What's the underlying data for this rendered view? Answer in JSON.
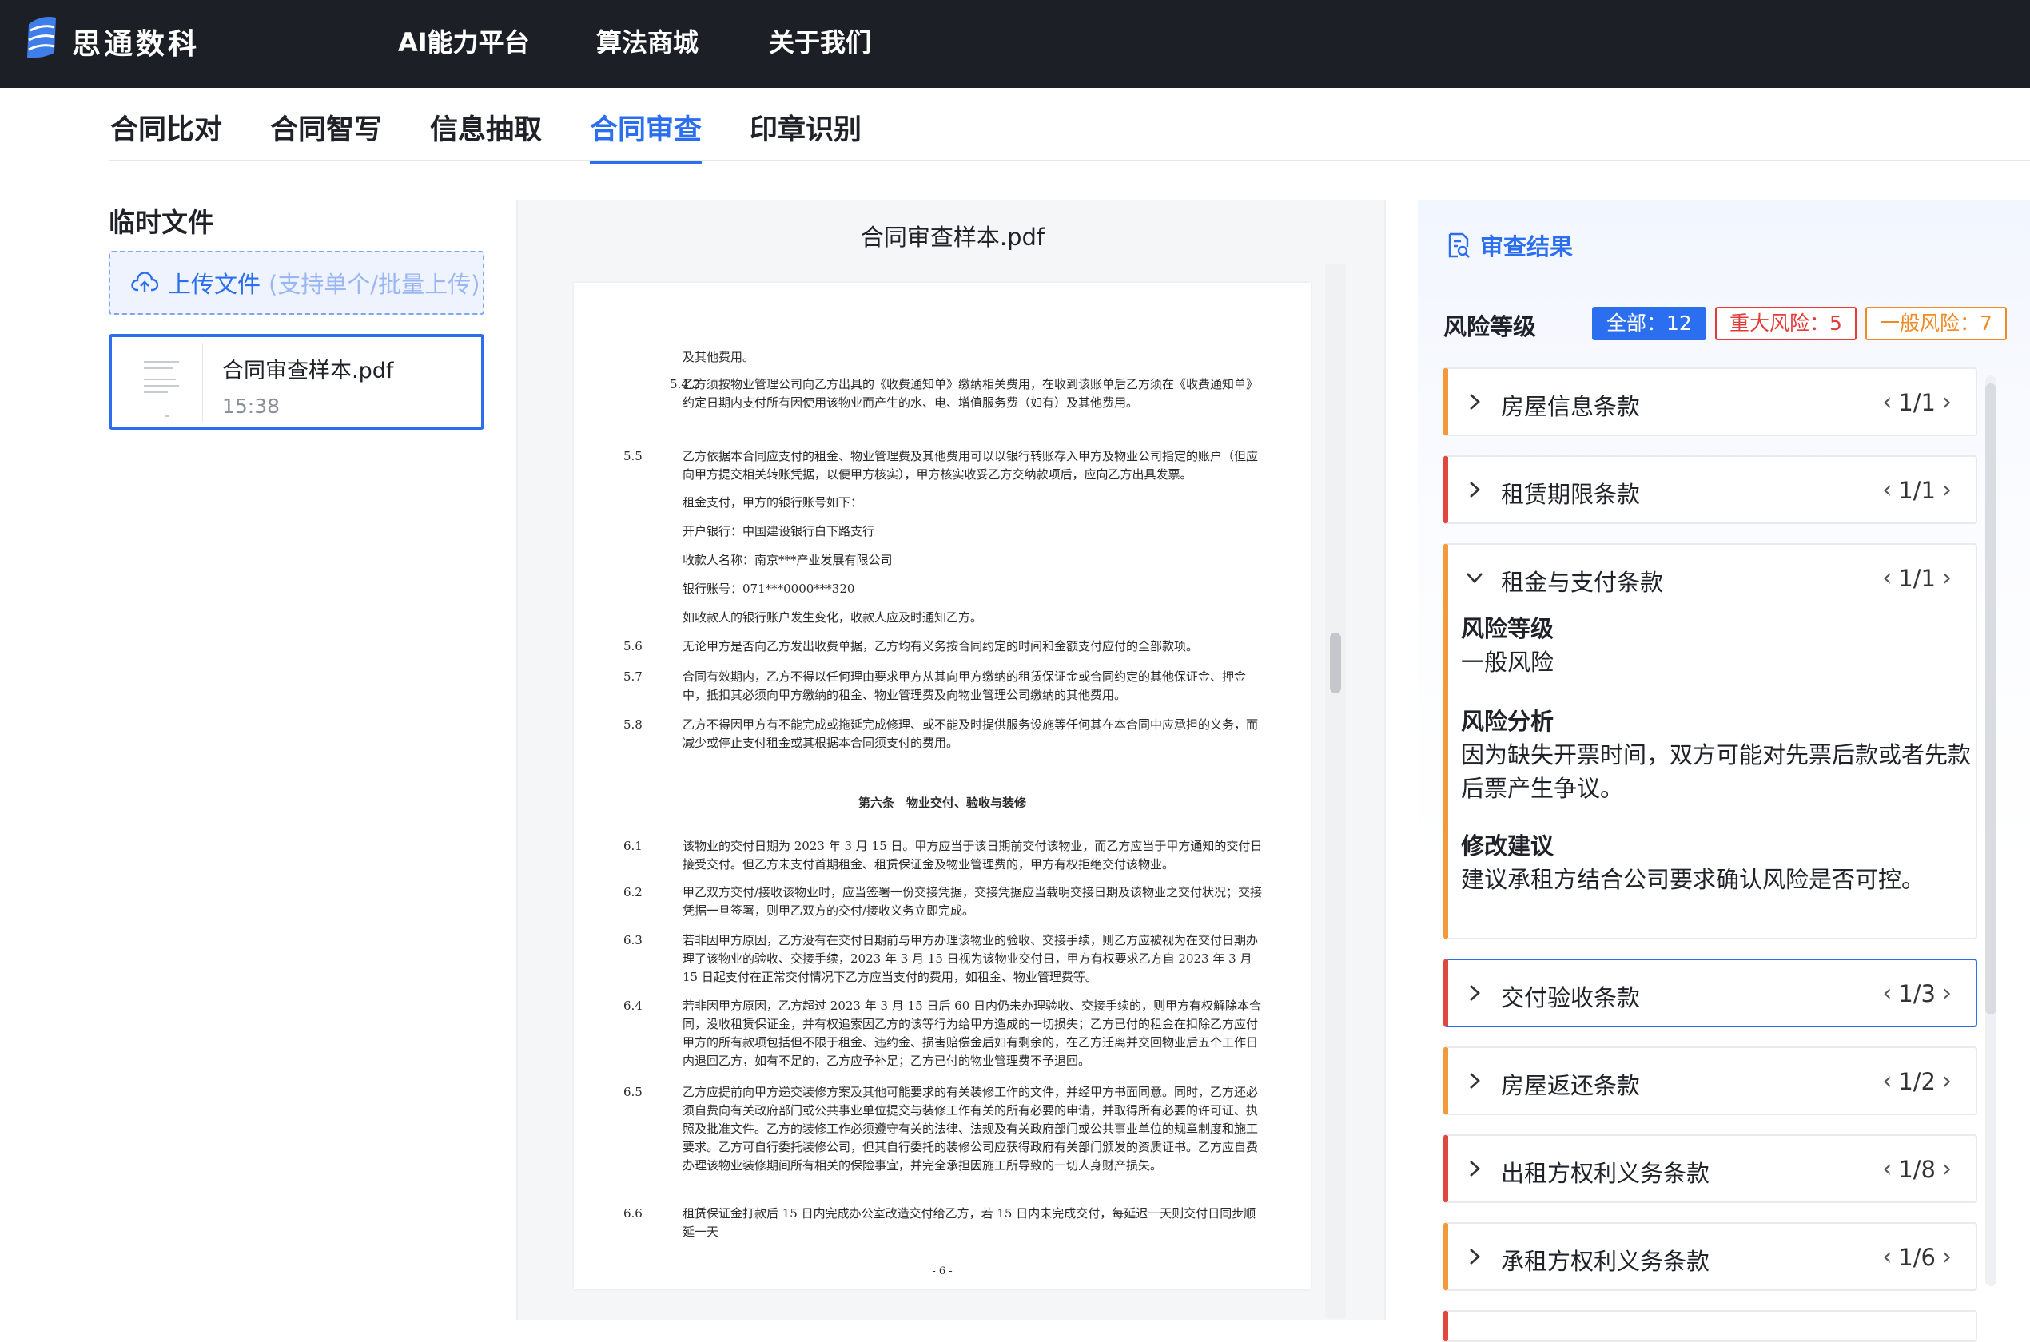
{
  "app": {
    "brand": "思通数科"
  },
  "topnav": [
    {
      "label": "AI能力平台"
    },
    {
      "label": "算法商城"
    },
    {
      "label": "关于我们"
    }
  ],
  "tabs": [
    {
      "label": "合同比对",
      "active": false
    },
    {
      "label": "合同智写",
      "active": false
    },
    {
      "label": "信息抽取",
      "active": false
    },
    {
      "label": "合同审查",
      "active": true
    },
    {
      "label": "印章识别",
      "active": false
    }
  ],
  "sidebar": {
    "title": "临时文件",
    "upload_label": "上传文件",
    "upload_hint": "(支持单个/批量上传)",
    "files": [
      {
        "name": "合同审查样本.pdf",
        "time": "15:38"
      }
    ]
  },
  "viewer": {
    "title": "合同审查样本.pdf",
    "page_number": "- 6 -",
    "clauses": [
      {
        "num": "",
        "text": "及其他费用。"
      },
      {
        "num": "5.4.2",
        "text": "乙方须按物业管理公司向乙方出具的《收费通知单》缴纳相关费用，在收到该账单后乙方须在《收费通知单》约定日期内支付所有因使用该物业而产生的水、电、增值服务费（如有）及其他费用。"
      },
      {
        "num": "5.5",
        "text": "乙方依据本合同应支付的租金、物业管理费及其他费用可以以银行转账存入甲方及物业公司指定的账户（但应向甲方提交相关转账凭据，以便甲方核实），甲方核实收妥乙方交纳款项后，应向乙方出具发票。"
      },
      {
        "num": "",
        "text": "租金支付，甲方的银行账号如下："
      },
      {
        "num": "",
        "text": "开户银行：中国建设银行白下路支行"
      },
      {
        "num": "",
        "text": "收款人名称：南京***产业发展有限公司"
      },
      {
        "num": "",
        "text": "银行账号：071***0000***320"
      },
      {
        "num": "",
        "text": "如收款人的银行账户发生变化，收款人应及时通知乙方。"
      },
      {
        "num": "5.6",
        "text": "无论甲方是否向乙方发出收费单据，乙方均有义务按合同约定的时间和金额支付应付的全部款项。"
      },
      {
        "num": "5.7",
        "text": "合同有效期内，乙方不得以任何理由要求甲方从其向甲方缴纳的租赁保证金或合同约定的其他保证金、押金中，抵扣其必须向甲方缴纳的租金、物业管理费及向物业管理公司缴纳的其他费用。"
      },
      {
        "num": "5.8",
        "text": "乙方不得因甲方有不能完成或拖延完成修理、或不能及时提供服务设施等任何其在本合同中应承担的义务，而减少或停止支付租金或其根据本合同须支付的费用。"
      },
      {
        "num": "",
        "text": "第六条　物业交付、验收与装修"
      },
      {
        "num": "6.1",
        "text": "该物业的交付日期为 2023 年 3 月 15 日。甲方应当于该日期前交付该物业，而乙方应当于甲方通知的交付日接受交付。但乙方未支付首期租金、租赁保证金及物业管理费的，甲方有权拒绝交付该物业。"
      },
      {
        "num": "6.2",
        "text": "甲乙双方交付/接收该物业时，应当签署一份交接凭据，交接凭据应当载明交接日期及该物业之交付状况；交接凭据一旦签署，则甲乙双方的交付/接收义务立即完成。"
      },
      {
        "num": "6.3",
        "text": "若非因甲方原因，乙方没有在交付日期前与甲方办理该物业的验收、交接手续，则乙方应被视为在交付日期办理了该物业的验收、交接手续，2023 年 3 月 15 日视为该物业交付日，甲方有权要求乙方自 2023 年 3 月 15 日起支付在正常交付情况下乙方应当支付的费用，如租金、物业管理费等。"
      },
      {
        "num": "6.4",
        "text": "若非因甲方原因，乙方超过 2023 年 3 月 15 日后 60 日内仍未办理验收、交接手续的，则甲方有权解除本合同，没收租赁保证金，并有权追索因乙方的该等行为给甲方造成的一切损失；乙方已付的租金在扣除乙方应付甲方的所有款项包括但不限于租金、违约金、损害赔偿金后如有剩余的，在乙方迁离并交回物业后五个工作日内退回乙方，如有不足的，乙方应予补足；乙方已付的物业管理费不予退回。"
      },
      {
        "num": "6.5",
        "text": "乙方应提前向甲方递交装修方案及其他可能要求的有关装修工作的文件，并经甲方书面同意。同时，乙方还必须自费向有关政府部门或公共事业单位提交与装修工作有关的所有必要的申请，并取得所有必要的许可证、执照及批准文件。乙方的装修工作必须遵守有关的法律、法规及有关政府部门或公共事业单位的规章制度和施工要求。乙方可自行委托装修公司，但其自行委托的装修公司应获得政府有关部门颁发的资质证书。乙方应自费办理该物业装修期间所有相关的保险事宜，并完全承担因施工所导致的一切人身财产损失。"
      },
      {
        "num": "6.6",
        "text": "租赁保证金打款后 15 日内完成办公室改造交付给乙方，若 15 日内未完成交付，每延迟一天则交付日同步顺延一天"
      }
    ]
  },
  "results": {
    "title": "审查结果",
    "risk_label": "风险等级",
    "filters": {
      "all": "全部：12",
      "major": "重大风险：5",
      "minor": "一般风险：7"
    },
    "items": [
      {
        "name": "房屋信息条款",
        "pager": "1/1",
        "level": "minor",
        "expanded": false
      },
      {
        "name": "租赁期限条款",
        "pager": "1/1",
        "level": "major",
        "expanded": false
      },
      {
        "name": "租金与支付条款",
        "pager": "1/1",
        "level": "minor",
        "expanded": true,
        "detail": {
          "risk_level_label": "风险等级",
          "risk_level": "一般风险",
          "analysis_label": "风险分析",
          "analysis": "因为缺失开票时间，双方可能对先票后款或者先款后票产生争议。",
          "advice_label": "修改建议",
          "advice": "建议承租方结合公司要求确认风险是否可控。"
        }
      },
      {
        "name": "交付验收条款",
        "pager": "1/3",
        "level": "major",
        "expanded": false,
        "selected": true
      },
      {
        "name": "房屋返还条款",
        "pager": "1/2",
        "level": "minor",
        "expanded": false
      },
      {
        "name": "出租方权利义务条款",
        "pager": "1/8",
        "level": "major",
        "expanded": false
      },
      {
        "name": "承租方权利义务条款",
        "pager": "1/6",
        "level": "minor",
        "expanded": false
      }
    ]
  },
  "colors": {
    "accent": "#2b6ff0",
    "major": "#e23c39",
    "minor": "#f08a24",
    "topbar": "#1c1f25"
  }
}
